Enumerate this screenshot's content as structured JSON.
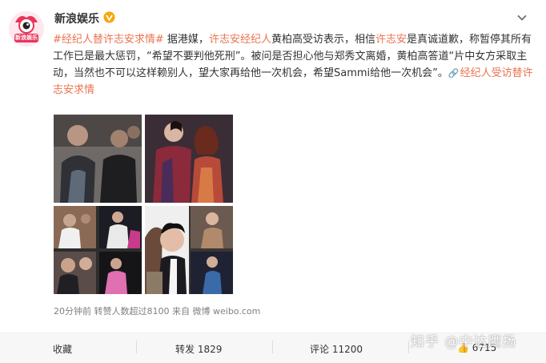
{
  "account": {
    "name": "新浪娱乐",
    "avatar_text": "新浪娱乐",
    "verified_icon": "verified-badge-icon"
  },
  "post": {
    "topic1": "#经纪人替许志安求情#",
    "text1": " 据港媒，",
    "link1": "许志安经纪人",
    "text2": "黄柏高受访表示，相信",
    "link2": "许志安",
    "text3": "是真诚道歉，称暂停其所有工作已是最大惩罚，“希望不要判他死刑”。被问是否担心他与郑秀文离婚，黄柏高答道“片中女方采取主动，当然也不可以这样赖别人，望大家再给他一次机会，希望Sammi给他一次机会”。",
    "topic2": "经纪人受访替许志安求情"
  },
  "meta": {
    "time": "20分钟前",
    "reposts_note": "转赞人数超过8100",
    "source_prefix": "来自",
    "source": "微博 weibo.com"
  },
  "actions": {
    "favorite": "收藏",
    "repost": "转发 1829",
    "comment": "评论 11200",
    "like": "6715"
  },
  "watermark": "知乎 @中达鹰扬",
  "colors": {
    "accent": "#eb7350",
    "verified": "#f7a70b"
  }
}
